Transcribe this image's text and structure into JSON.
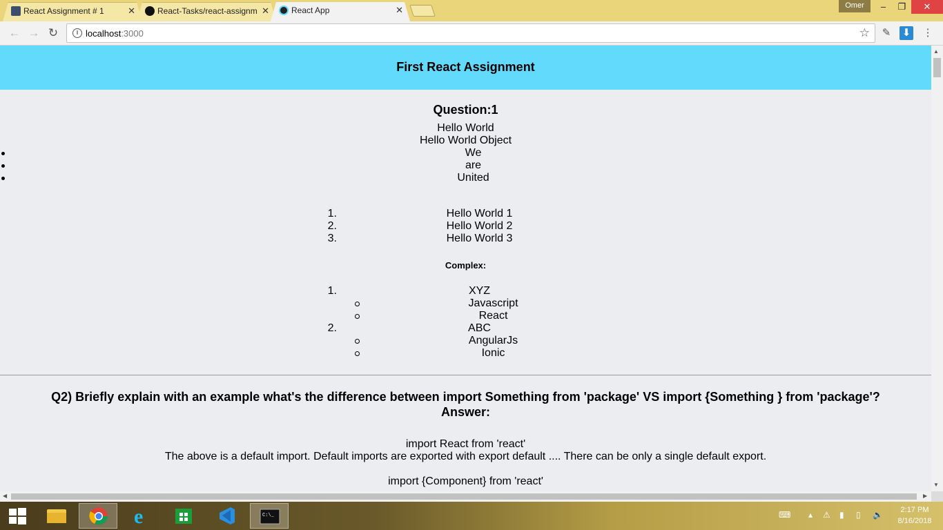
{
  "browser": {
    "tabs": [
      {
        "title": "React Assignment # 1",
        "icon": "contact-card-icon",
        "active": false
      },
      {
        "title": "React-Tasks/react-assignm",
        "icon": "github-icon",
        "active": false
      },
      {
        "title": "React App",
        "icon": "react-logo-icon",
        "active": true
      }
    ],
    "profile_name": "Omer",
    "url_host": "localhost",
    "url_port": ":3000"
  },
  "page": {
    "header_title": "First React Assignment",
    "q1": {
      "title": "Question:1",
      "lines": [
        "Hello World",
        "Hello World Object"
      ],
      "bullets": [
        "We",
        "are",
        "United"
      ],
      "ordered": [
        {
          "num": "1.",
          "text": "Hello World 1"
        },
        {
          "num": "2.",
          "text": "Hello World 2"
        },
        {
          "num": "3.",
          "text": "Hello World 3"
        }
      ],
      "complex_label": "Complex:",
      "complex": [
        {
          "num": "1.",
          "text": "XYZ",
          "children": [
            "Javascript",
            "React"
          ]
        },
        {
          "num": "2.",
          "text": "ABC",
          "children": [
            "AngularJs",
            "Ionic"
          ]
        }
      ]
    },
    "q2": {
      "question": "Q2) Briefly explain with an example what's the difference between import Something from 'package' VS import {Something } from 'package'?",
      "answer_label": "Answer:",
      "lines": [
        "import React from 'react'",
        "The above is a default import. Default imports are exported with export default .... There can be only a single default export.",
        "import {Component} from 'react'"
      ]
    }
  },
  "taskbar": {
    "apps": [
      "file-explorer-icon",
      "chrome-icon",
      "internet-explorer-icon",
      "store-icon",
      "vscode-icon",
      "command-prompt-icon"
    ],
    "time": "2:17 PM",
    "date": "8/16/2018"
  },
  "colors": {
    "header_bg": "#61dafb",
    "page_bg": "#ebedf0",
    "titlebar": "#ebd57a"
  }
}
